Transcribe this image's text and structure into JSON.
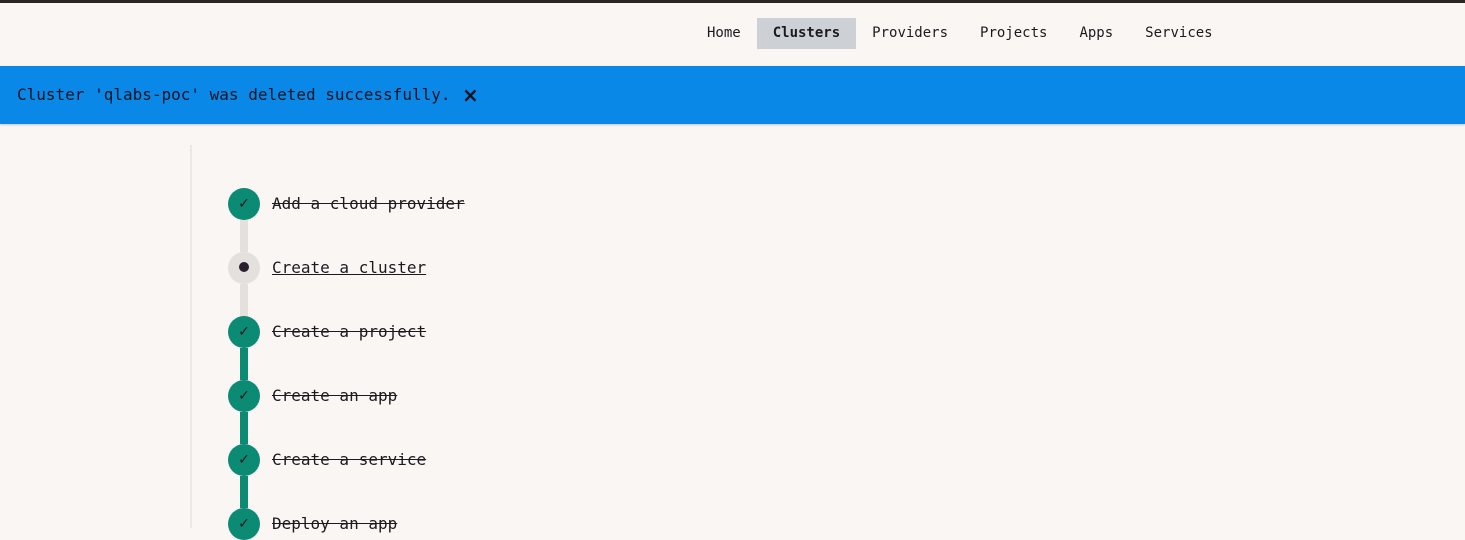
{
  "nav": {
    "items": [
      "Home",
      "Clusters",
      "Providers",
      "Projects",
      "Apps",
      "Services"
    ],
    "active": "Clusters"
  },
  "banner": {
    "message": "Cluster 'qlabs-poc' was deleted successfully.",
    "close_symbol": "×",
    "color": "#0a88e8"
  },
  "steps": [
    {
      "label": "Add a cloud provider",
      "status": "done",
      "icon": "check-icon",
      "symbol": "✓"
    },
    {
      "label": "Create a cluster",
      "status": "current",
      "icon": "dot-icon",
      "symbol": ""
    },
    {
      "label": "Create a project",
      "status": "done",
      "icon": "check-icon",
      "symbol": "✓"
    },
    {
      "label": "Create an app",
      "status": "done",
      "icon": "check-icon",
      "symbol": "✓"
    },
    {
      "label": "Create a service",
      "status": "done",
      "icon": "check-icon",
      "symbol": "✓"
    },
    {
      "label": "Deploy an app",
      "status": "done",
      "icon": "check-icon",
      "symbol": "✓"
    }
  ],
  "colors": {
    "done": "#0b8a74",
    "pending": "#e4e0dd",
    "active_nav": "#cdd1d6"
  }
}
